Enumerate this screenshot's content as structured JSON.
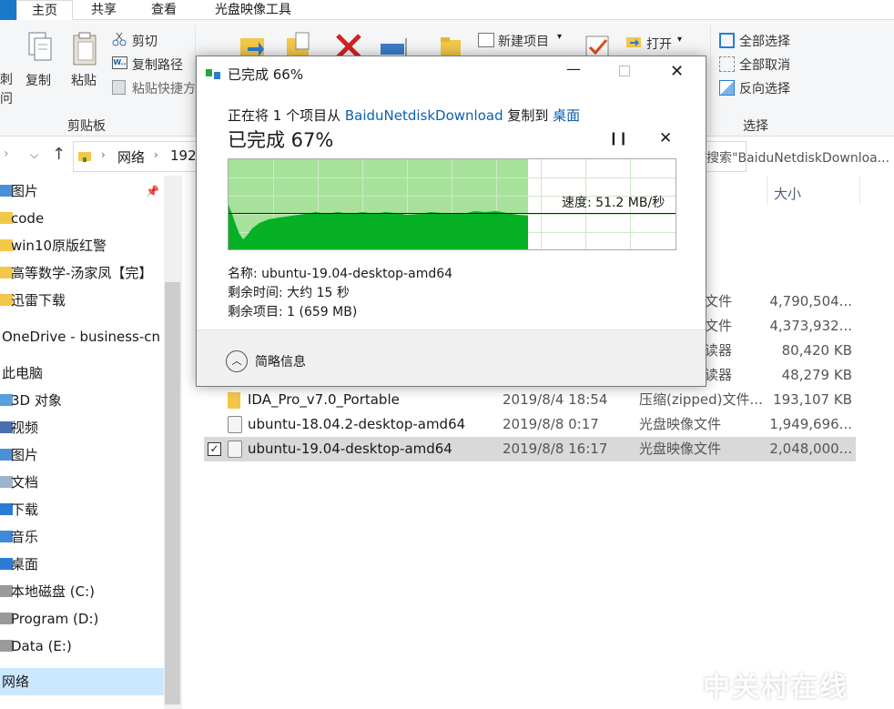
{
  "ribbon": {
    "tabs": [
      "主页",
      "共享",
      "查看",
      "光盘映像工具"
    ],
    "clipboard": {
      "copy_label": "复制",
      "paste_label": "粘贴",
      "cut_label": "剪切",
      "copy_path_label": "复制路径",
      "paste_shortcut_label": "粘贴快捷方",
      "group_label": "剪贴板",
      "partial_left_1": "刺",
      "partial_left_2": "问"
    },
    "new_item_label": "新建项目",
    "open_label": "打开",
    "select": {
      "select_all": "全部选择",
      "select_none": "全部取消",
      "invert": "反向选择",
      "group_label": "选择"
    }
  },
  "address_bar": {
    "crumb_network": "网络",
    "crumb_partial": "192.",
    "search_placeholder": "搜索\"BaiduNetdiskDownloa..."
  },
  "sidebar": {
    "items": [
      {
        "label": "图片"
      },
      {
        "label": "code"
      },
      {
        "label": "win10原版红警"
      },
      {
        "label": "高等数学-汤家凤【完】"
      },
      {
        "label": "迅雷下载"
      },
      {
        "label": "OneDrive - business-cn"
      },
      {
        "label": "此电脑"
      },
      {
        "label": "3D 对象"
      },
      {
        "label": "视频"
      },
      {
        "label": "图片"
      },
      {
        "label": "文档"
      },
      {
        "label": "下载"
      },
      {
        "label": "音乐"
      },
      {
        "label": "桌面"
      },
      {
        "label": "本地磁盘 (C:)"
      },
      {
        "label": "Program (D:)"
      },
      {
        "label": "Data (E:)"
      },
      {
        "label": "网络"
      }
    ]
  },
  "file_list": {
    "size_header": "大小",
    "partial_rows": [
      {
        "type": "文件",
        "size": "4,790,504..."
      },
      {
        "type": "文件",
        "size": "4,373,932..."
      },
      {
        "type": "读器",
        "size": "80,420 KB"
      },
      {
        "type": "读器",
        "size": "48,279 KB"
      }
    ],
    "rows": [
      {
        "name": "IDA_Pro_v7.0_Portable",
        "date": "2019/8/4 18:54",
        "type": "压缩(zipped)文件...",
        "size": "193,107 KB"
      },
      {
        "name": "ubuntu-18.04.2-desktop-amd64",
        "date": "2019/8/8 0:17",
        "type": "光盘映像文件",
        "size": "1,949,696..."
      },
      {
        "name": "ubuntu-19.04-desktop-amd64",
        "date": "2019/8/8 16:17",
        "type": "光盘映像文件",
        "size": "2,048,000..."
      }
    ]
  },
  "dialog": {
    "title": "已完成 66%",
    "line_prefix": "正在将 1 个项目从 ",
    "source": "BaiduNetdiskDownload",
    "line_mid": " 复制到 ",
    "dest": "桌面",
    "progress_text": "已完成 67%",
    "progress_fraction": 0.67,
    "speed": "速度: 51.2 MB/秒",
    "name_line": "名称: ubuntu-19.04-desktop-amd64",
    "time_line": "剩余时间: 大约 15 秒",
    "items_line": "剩余项目: 1 (659 MB)",
    "details_toggle": "简略信息",
    "colors": {
      "progress_fill": "#a6e29a",
      "speed_fill": "#06b025",
      "link": "#0b61b0"
    }
  },
  "watermark": "中关村在线"
}
